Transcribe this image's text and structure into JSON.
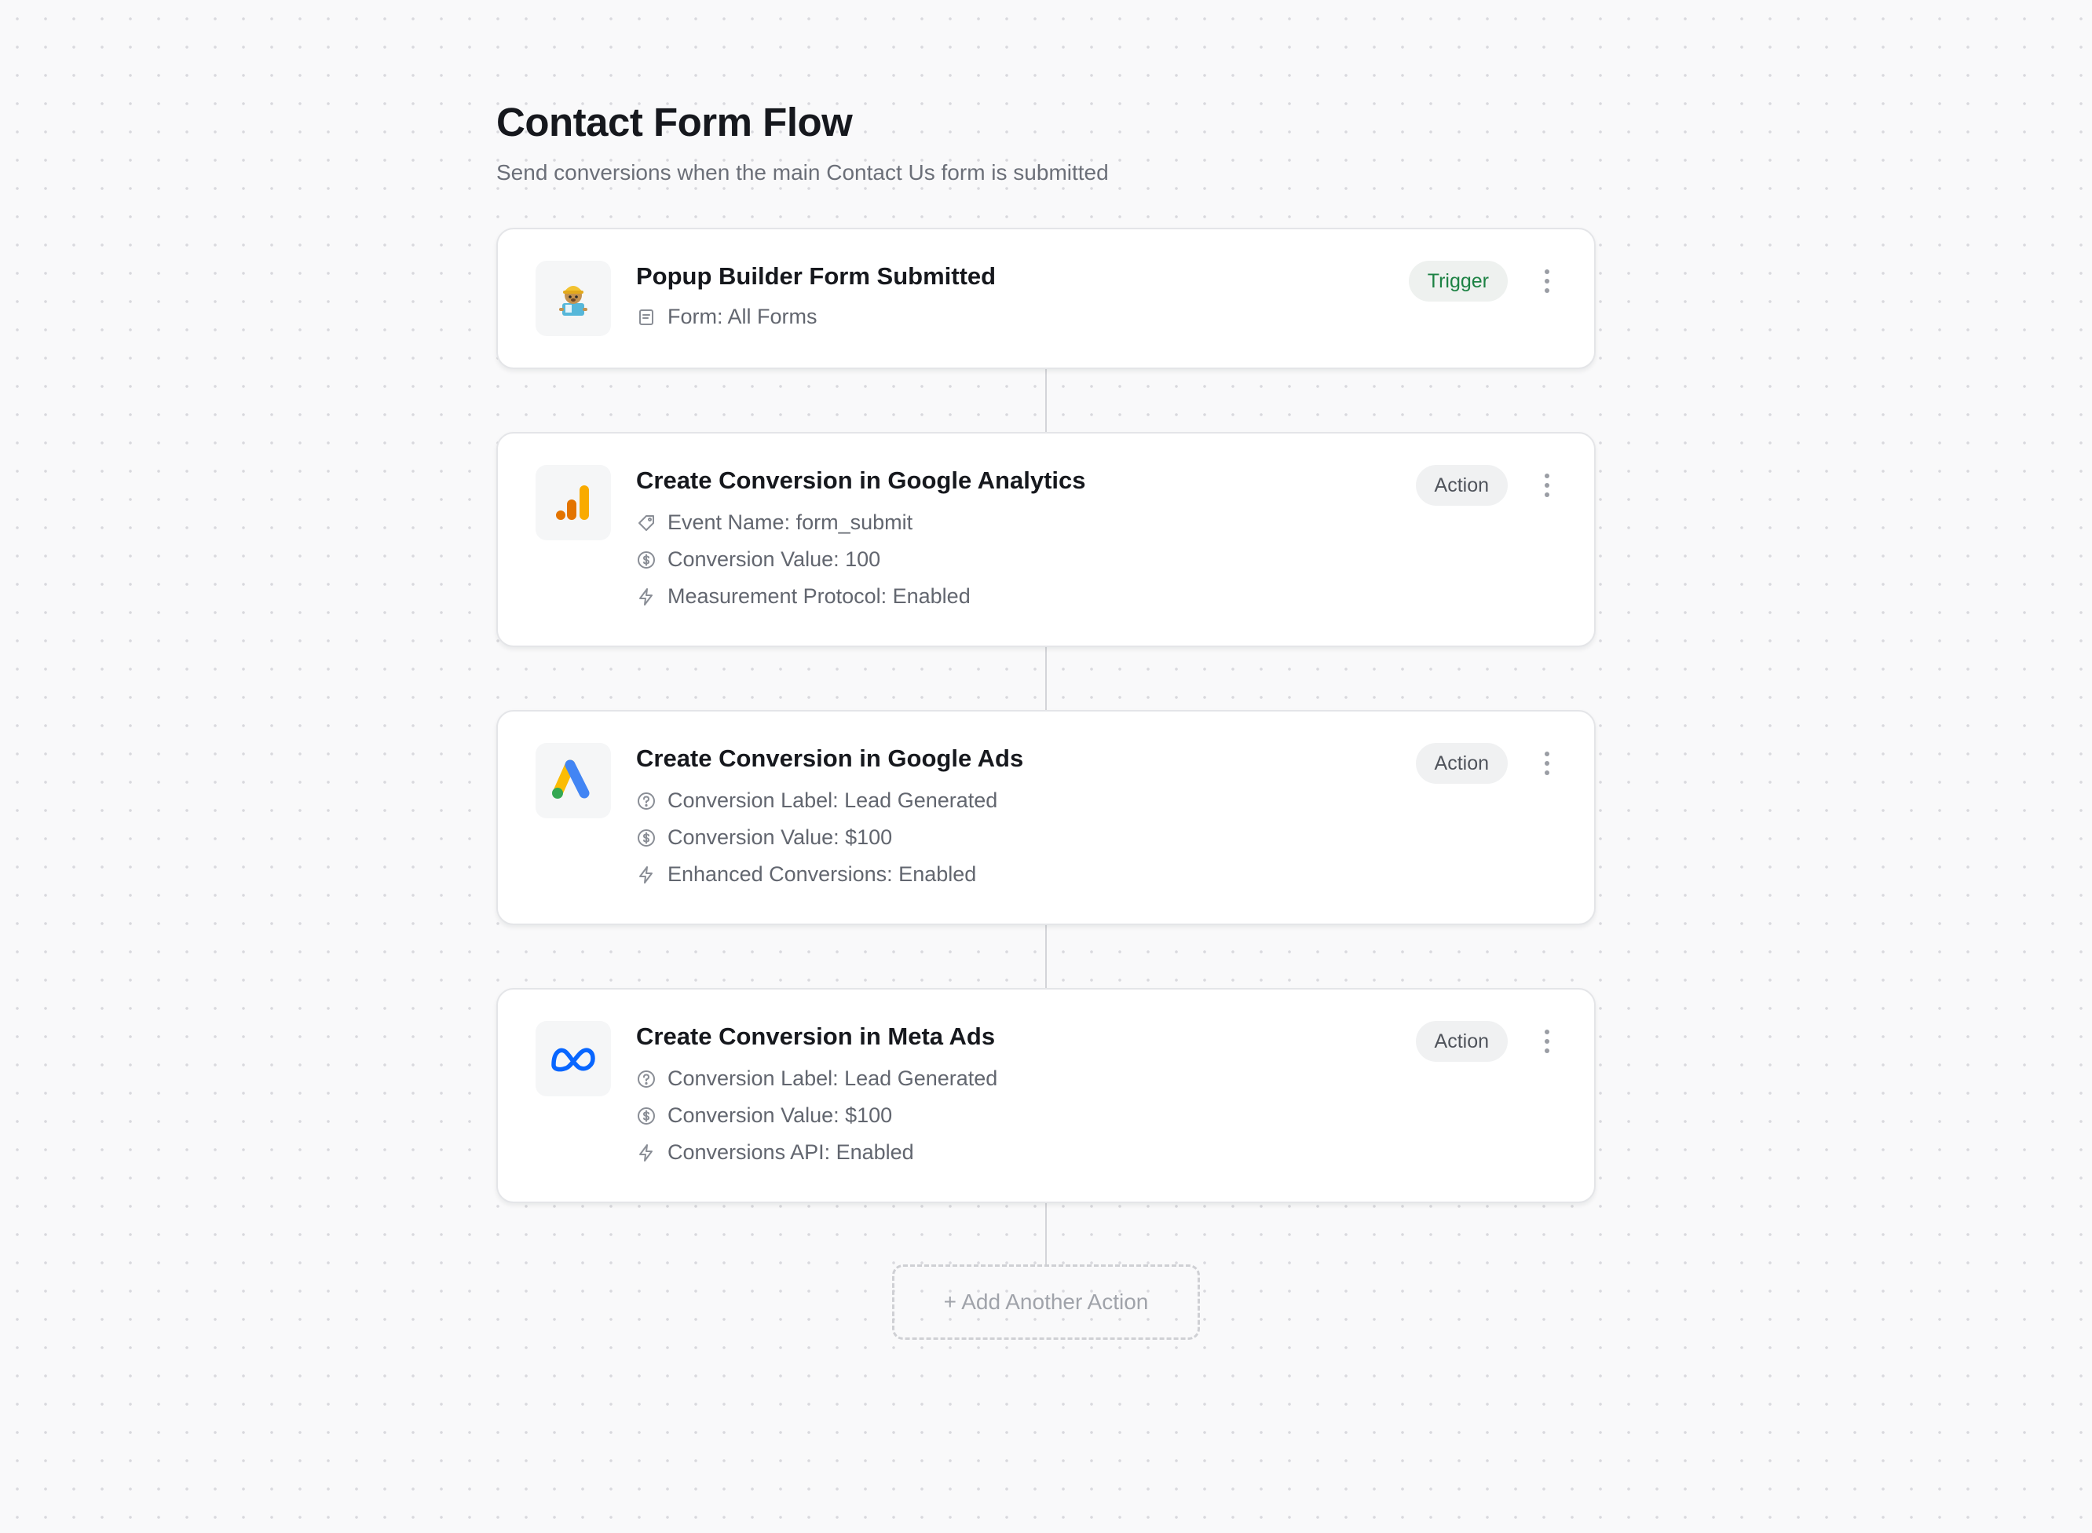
{
  "header": {
    "title": "Contact Form Flow",
    "subtitle": "Send conversions when the main Contact Us form is submitted"
  },
  "steps": [
    {
      "title": "Popup Builder Form Submitted",
      "badge": "Trigger",
      "icon": "popup-builder-mascot-icon",
      "details": [
        {
          "icon": "form-icon",
          "text": "Form: All Forms"
        }
      ]
    },
    {
      "title": "Create Conversion in Google Analytics",
      "badge": "Action",
      "icon": "google-analytics-icon",
      "details": [
        {
          "icon": "tag-icon",
          "text": "Event Name: form_submit"
        },
        {
          "icon": "dollar-circle-icon",
          "text": "Conversion Value: 100"
        },
        {
          "icon": "lightning-icon",
          "text": "Measurement Protocol: Enabled"
        }
      ]
    },
    {
      "title": "Create Conversion in Google Ads",
      "badge": "Action",
      "icon": "google-ads-icon",
      "details": [
        {
          "icon": "question-circle-icon",
          "text": "Conversion Label: Lead Generated"
        },
        {
          "icon": "dollar-circle-icon",
          "text": "Conversion Value: $100"
        },
        {
          "icon": "lightning-icon",
          "text": "Enhanced Conversions: Enabled"
        }
      ]
    },
    {
      "title": "Create Conversion in Meta Ads",
      "badge": "Action",
      "icon": "meta-icon",
      "details": [
        {
          "icon": "question-circle-icon",
          "text": "Conversion Label: Lead Generated"
        },
        {
          "icon": "dollar-circle-icon",
          "text": "Conversion Value: $100"
        },
        {
          "icon": "lightning-icon",
          "text": "Conversions API: Enabled"
        }
      ]
    }
  ],
  "add_action_label": "+ Add Another Action",
  "colors": {
    "trigger_text": "#1d8244",
    "google_ads_blue": "#4285f4",
    "google_ads_yellow": "#fbbc04",
    "google_ads_green": "#34a853",
    "google_analytics_orange": "#f9ab00",
    "google_analytics_dark_orange": "#e37400",
    "meta_blue": "#0866ff"
  }
}
